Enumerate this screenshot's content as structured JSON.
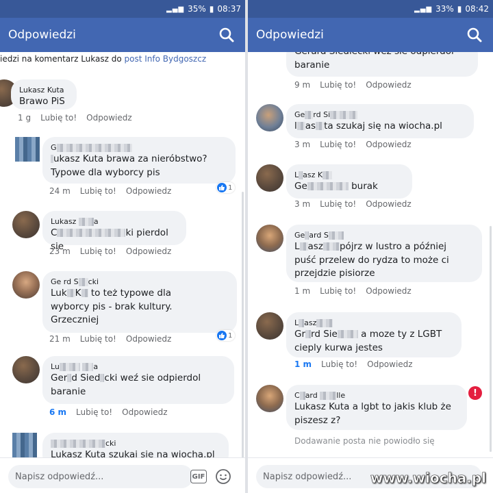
{
  "left": {
    "status": {
      "battery": "35%",
      "time": "08:37"
    },
    "title": "Odpowiedzi",
    "context": {
      "text": "iedzi na komentarz Lukasz do ",
      "link": "post Info Bydgoszcz"
    },
    "comments": [
      {
        "name": "Lukasz Kuta",
        "text": "Brawo PiS",
        "time": "1 g",
        "like": "Lubię to!",
        "reply": "Odpowiedz"
      },
      {
        "name": "G",
        "text_a": "ukasz Kuta brawa za nieróbstwo?",
        "text_b": "Typowe dla wyborcy pis",
        "time": "24 m",
        "like": "Lubię to!",
        "reply": "Odpowiedz",
        "reactions": "1"
      },
      {
        "name": "Lukasz",
        "name_end": "a",
        "text_a": "C",
        "text_b": "ki pierdol sie",
        "time": "23 m",
        "like": "Lubię to!",
        "reply": "Odpowiedz"
      },
      {
        "name": "Ge",
        "name_b": "rd S",
        "name_c": "cki",
        "text_a": "Luk",
        "text_b": "K",
        "text_c": "to też typowe dla",
        "text_d": "wyborcy pis - brak kultury.",
        "text_e": "Grzeczniej",
        "time": "21 m",
        "like": "Lubię to!",
        "reply": "Odpowiedz",
        "reactions": "1"
      },
      {
        "name": "Lu",
        "name_b": "a",
        "text_a": "Ger",
        "text_b": "d Sied",
        "text_c": "cki weź sie odpierdol",
        "text_d": "baranie",
        "time": "6 m",
        "like": "Lubię to!",
        "reply": "Odpowiedz"
      },
      {
        "name": "cki",
        "text": "Lukasz Kuta szukaj sie na wiocha.pl"
      }
    ],
    "composer_placeholder": "Napisz odpowiedź...",
    "gif_label": "GIF"
  },
  "right": {
    "status": {
      "battery": "33%",
      "time": "08:42"
    },
    "title": "Odpowiedzi",
    "comments": [
      {
        "text_a": "Gerard Siedlecki weź sie odpierdol",
        "text_b": "baranie",
        "time": "9 m",
        "like": "Lubię to!",
        "reply": "Odpowiedz"
      },
      {
        "name": "Ge",
        "name_b": "rd Si",
        "text_a": "l",
        "text_b": "as",
        "text_c": "ta szukaj się na wiocha.pl",
        "time": "3 m",
        "like": "Lubię to!",
        "reply": "Odpowiedz"
      },
      {
        "name": "L",
        "name_b": "asz K",
        "text_a": "Ge",
        "text_b": "burak",
        "time": "3 m",
        "like": "Lubię to!",
        "reply": "Odpowiedz"
      },
      {
        "name": "Ge",
        "name_b": "ard S",
        "text_a": "L",
        "text_b": "asz",
        "text_c": "pójrz w lustro a później",
        "text_d": "puść przelew do rydza to może ci",
        "text_e": "przejdzie pisiorze",
        "time": "1 m",
        "like": "Lubię to!",
        "reply": "Odpowiedz"
      },
      {
        "name": "L",
        "name_b": "asz",
        "text_a": "Gr",
        "text_b": "rd Sie",
        "text_c": "a moze ty z LGBT",
        "text_d": "cieply kurwa jestes",
        "time": "1 m",
        "like": "Lubię to!",
        "reply": "Odpowiedz"
      },
      {
        "name": "C",
        "name_b": "ard",
        "name_c": "lle",
        "text_a": "Lukasz Kuta a lgbt to jakis klub że",
        "text_b": "piszesz z?",
        "error": "Dodawanie posta nie powiodło się",
        "error_badge": "!"
      }
    ],
    "composer_placeholder": "Napisz odpowiedź..."
  },
  "watermark": "www.wiocha.pl",
  "colors": {
    "appbar": "#4267b2",
    "statusbar": "#385898",
    "bubble": "#f0f2f5",
    "link": "#1877f2",
    "error": "#e41e3f"
  }
}
